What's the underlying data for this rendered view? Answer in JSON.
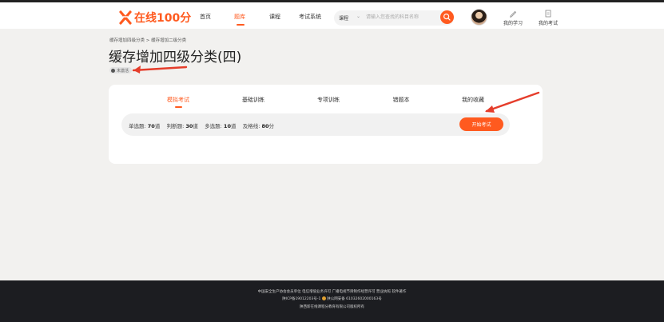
{
  "brand": {
    "name": "在线100分",
    "accent": "#ff5a1f"
  },
  "nav": [
    {
      "label": "首页",
      "active": false
    },
    {
      "label": "题库",
      "active": true
    },
    {
      "label": "课程",
      "active": false
    },
    {
      "label": "考试系统",
      "active": false
    }
  ],
  "search": {
    "category": "课程",
    "placeholder": "请输入您查找的科目名称"
  },
  "user_tools": [
    {
      "label": "我的学习",
      "icon": "pencil-icon"
    },
    {
      "label": "我的考试",
      "icon": "exam-paper-icon"
    }
  ],
  "breadcrumb": "缓存增加四级分类 > 缓存增加二级分类",
  "page_title": "缓存增加四级分类(四)",
  "status_badge": "未激活",
  "tabs": [
    {
      "label": "模拟考试",
      "active": true
    },
    {
      "label": "基础训练",
      "active": false
    },
    {
      "label": "专项训练",
      "active": false
    },
    {
      "label": "错题本",
      "active": false
    },
    {
      "label": "我的收藏",
      "active": false
    }
  ],
  "exam_info": {
    "single_label": "单选题",
    "single_count": "70",
    "single_unit": "道",
    "judge_label": "判断题",
    "judge_count": "30",
    "judge_unit": "道",
    "multi_label": "多选题",
    "multi_count": "10",
    "multi_unit": "道",
    "pass_label": "及格线",
    "pass_score": "80",
    "pass_unit": "分"
  },
  "start_button": "开始考试",
  "footer": {
    "line1": "中国安全生产协会会员单位  电信增值业务许可  广播电视节目制作经营许可  营业执照  软件著作",
    "line2_a": "陕ICP备19012203号-1",
    "line2_b": "陕公网安备 61032602000163号",
    "line3": "陕西新在线课程分教育有限公司版权所有"
  }
}
